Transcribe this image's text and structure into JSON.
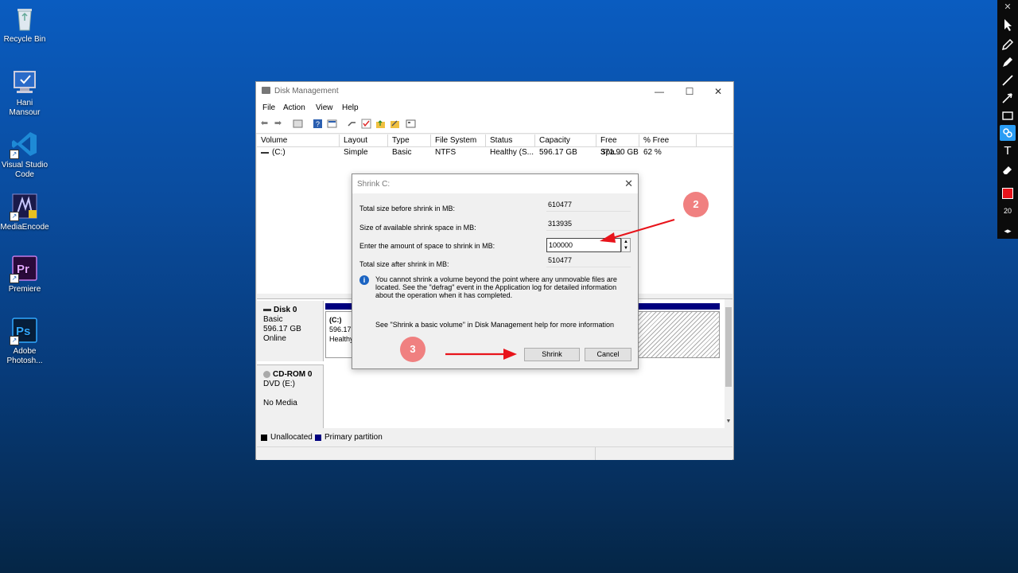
{
  "desktop": {
    "icons": [
      {
        "label": "Recycle Bin"
      },
      {
        "label": "Hani Mansour"
      },
      {
        "label": "Visual Studio Code"
      },
      {
        "label": "MediaEncode"
      },
      {
        "label": "Premiere"
      },
      {
        "label": "Adobe Photosh..."
      }
    ]
  },
  "toolbar": {
    "close": "✕",
    "size_value": "20",
    "color": "#e8141b"
  },
  "window": {
    "title": "Disk Management",
    "menu": [
      "File",
      "Action",
      "View",
      "Help"
    ],
    "columns": [
      "Volume",
      "Layout",
      "Type",
      "File System",
      "Status",
      "Capacity",
      "Free Spa...",
      "% Free"
    ],
    "rows": [
      [
        "(C:)",
        "Simple",
        "Basic",
        "NTFS",
        "Healthy (S...",
        "596.17 GB",
        "371.90 GB",
        "62 %"
      ]
    ],
    "disks": [
      {
        "name": "Disk 0",
        "lines": [
          "Basic",
          "596.17 GB",
          "Online"
        ],
        "partition": {
          "label": "(C:)",
          "size": "596.17",
          "status": "Healthy"
        }
      },
      {
        "name": "CD-ROM 0",
        "lines": [
          "DVD (E:)",
          "",
          "No Media"
        ]
      }
    ],
    "legend": [
      {
        "label": "Unallocated",
        "color": "#000000"
      },
      {
        "label": "Primary partition",
        "color": "#00007f"
      }
    ]
  },
  "dialog": {
    "title": "Shrink C:",
    "total_before_label": "Total size before shrink in MB:",
    "total_before_value": "610477",
    "available_label": "Size of available shrink space in MB:",
    "available_value": "313935",
    "amount_label": "Enter the amount of space to shrink in MB:",
    "amount_value": "100000",
    "total_after_label": "Total size after shrink in MB:",
    "total_after_value": "510477",
    "info": "You cannot shrink a volume beyond the point where any unmovable files are located. See the \"defrag\" event in the Application log for detailed information about the operation when it has completed.",
    "help": "See \"Shrink a basic volume\" in Disk Management help for more information",
    "shrink_button": "Shrink",
    "cancel_button": "Cancel"
  },
  "annotations": {
    "step2": "2",
    "step3": "3",
    "arrow_color": "#e8141b"
  }
}
